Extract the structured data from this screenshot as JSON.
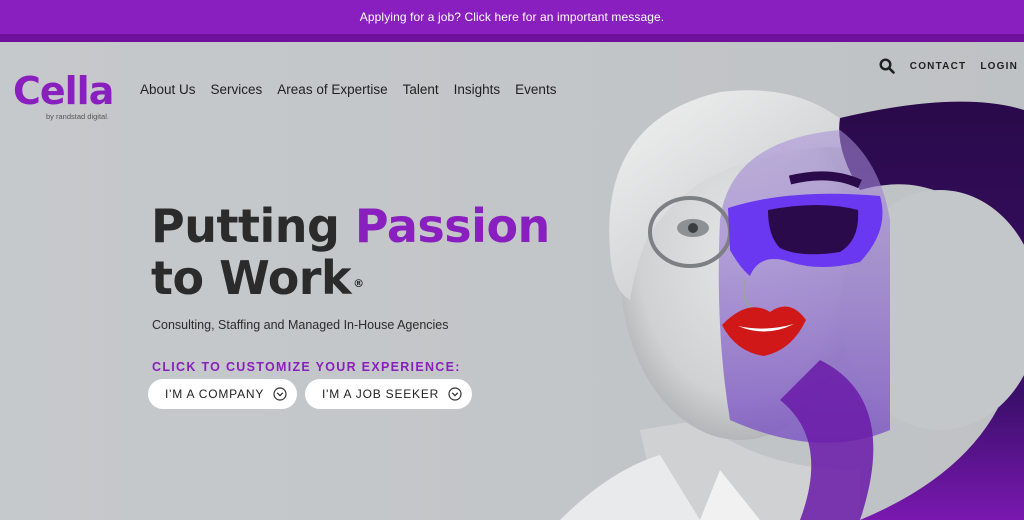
{
  "banner": {
    "text": "Applying for a job? Click here for an important message."
  },
  "logo": {
    "word": "Cella",
    "sub": "by randstad digital."
  },
  "nav": {
    "items": [
      {
        "label": "About Us"
      },
      {
        "label": "Services"
      },
      {
        "label": "Areas of Expertise"
      },
      {
        "label": "Talent"
      },
      {
        "label": "Insights"
      },
      {
        "label": "Events"
      }
    ]
  },
  "utility": {
    "search_icon": "search-icon",
    "contact": "CONTACT",
    "login": "LOGIN"
  },
  "hero": {
    "headline_line1_a": "Putting ",
    "headline_line1_b": "Passion",
    "headline_line2": "to Work",
    "registered": "®",
    "tagline": "Consulting, Staffing and Managed In-House Agencies",
    "cta_label": "CLICK TO CUSTOMIZE YOUR EXPERIENCE:",
    "buttons": [
      {
        "label": "I'M A COMPANY",
        "icon": "chevron-down-circle-icon"
      },
      {
        "label": "I'M A JOB SEEKER",
        "icon": "chevron-down-circle-icon"
      }
    ]
  },
  "colors": {
    "brand_purple": "#8a1fbf",
    "dark_purple": "#2a0a4a",
    "text": "#2b2b2b",
    "lips": "#d01818"
  }
}
